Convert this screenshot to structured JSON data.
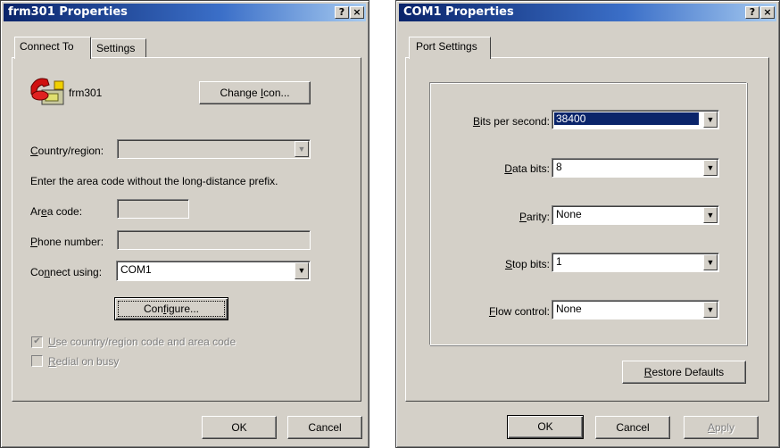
{
  "left_window": {
    "title": "frm301 Properties",
    "help_btn": "?",
    "close_btn": "×",
    "tabs": [
      {
        "label": "Connect To"
      },
      {
        "label": "Settings"
      }
    ],
    "connection_name": "frm301",
    "change_icon_pre": "Change ",
    "change_icon_u": "I",
    "change_icon_post": "con...",
    "country_u": "C",
    "country_rest": "ountry/region:",
    "area_note": "Enter the area code without the long-distance prefix.",
    "area_pre": "Ar",
    "area_u": "e",
    "area_post": "a code:",
    "phone_u": "P",
    "phone_rest": "hone number:",
    "connect_pre": "Co",
    "connect_u": "n",
    "connect_post": "nect using:",
    "connect_value": "COM1",
    "configure_pre": "Con",
    "configure_u": "f",
    "configure_post": "igure...",
    "use_country_u": "U",
    "use_country_rest": "se country/region code and area code",
    "redial_u": "R",
    "redial_rest": "edial on busy",
    "ok": "OK",
    "cancel": "Cancel"
  },
  "right_window": {
    "title": "COM1 Properties",
    "help_btn": "?",
    "close_btn": "×",
    "tabs": [
      {
        "label": "Port Settings"
      }
    ],
    "bits_u": "B",
    "bits_rest": "its per second:",
    "bits_value": "38400",
    "data_u": "D",
    "data_rest": "ata bits:",
    "data_value": "8",
    "parity_u": "P",
    "parity_rest": "arity:",
    "parity_value": "None",
    "stop_u": "S",
    "stop_rest": "top bits:",
    "stop_value": "1",
    "flow_u": "F",
    "flow_rest": "low control:",
    "flow_value": "None",
    "restore_u": "R",
    "restore_rest": "estore Defaults",
    "ok": "OK",
    "cancel": "Cancel",
    "apply_u": "A",
    "apply_rest": "pply"
  },
  "icons": {
    "dropdown": "▼",
    "check": "✔",
    "phone": "phone-icon"
  }
}
